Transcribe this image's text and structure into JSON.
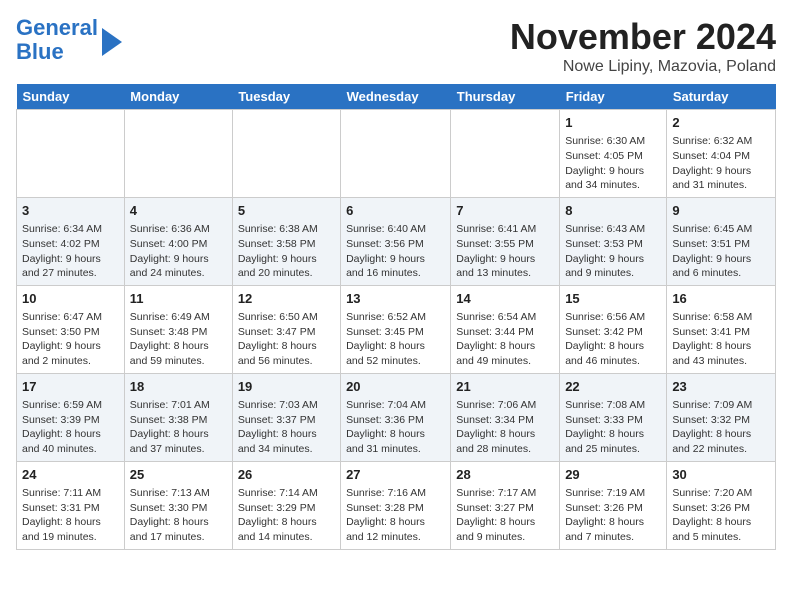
{
  "logo": {
    "line1": "General",
    "line2": "Blue"
  },
  "title": "November 2024",
  "location": "Nowe Lipiny, Mazovia, Poland",
  "weekdays": [
    "Sunday",
    "Monday",
    "Tuesday",
    "Wednesday",
    "Thursday",
    "Friday",
    "Saturday"
  ],
  "weeks": [
    [
      {
        "day": "",
        "info": ""
      },
      {
        "day": "",
        "info": ""
      },
      {
        "day": "",
        "info": ""
      },
      {
        "day": "",
        "info": ""
      },
      {
        "day": "",
        "info": ""
      },
      {
        "day": "1",
        "info": "Sunrise: 6:30 AM\nSunset: 4:05 PM\nDaylight: 9 hours\nand 34 minutes."
      },
      {
        "day": "2",
        "info": "Sunrise: 6:32 AM\nSunset: 4:04 PM\nDaylight: 9 hours\nand 31 minutes."
      }
    ],
    [
      {
        "day": "3",
        "info": "Sunrise: 6:34 AM\nSunset: 4:02 PM\nDaylight: 9 hours\nand 27 minutes."
      },
      {
        "day": "4",
        "info": "Sunrise: 6:36 AM\nSunset: 4:00 PM\nDaylight: 9 hours\nand 24 minutes."
      },
      {
        "day": "5",
        "info": "Sunrise: 6:38 AM\nSunset: 3:58 PM\nDaylight: 9 hours\nand 20 minutes."
      },
      {
        "day": "6",
        "info": "Sunrise: 6:40 AM\nSunset: 3:56 PM\nDaylight: 9 hours\nand 16 minutes."
      },
      {
        "day": "7",
        "info": "Sunrise: 6:41 AM\nSunset: 3:55 PM\nDaylight: 9 hours\nand 13 minutes."
      },
      {
        "day": "8",
        "info": "Sunrise: 6:43 AM\nSunset: 3:53 PM\nDaylight: 9 hours\nand 9 minutes."
      },
      {
        "day": "9",
        "info": "Sunrise: 6:45 AM\nSunset: 3:51 PM\nDaylight: 9 hours\nand 6 minutes."
      }
    ],
    [
      {
        "day": "10",
        "info": "Sunrise: 6:47 AM\nSunset: 3:50 PM\nDaylight: 9 hours\nand 2 minutes."
      },
      {
        "day": "11",
        "info": "Sunrise: 6:49 AM\nSunset: 3:48 PM\nDaylight: 8 hours\nand 59 minutes."
      },
      {
        "day": "12",
        "info": "Sunrise: 6:50 AM\nSunset: 3:47 PM\nDaylight: 8 hours\nand 56 minutes."
      },
      {
        "day": "13",
        "info": "Sunrise: 6:52 AM\nSunset: 3:45 PM\nDaylight: 8 hours\nand 52 minutes."
      },
      {
        "day": "14",
        "info": "Sunrise: 6:54 AM\nSunset: 3:44 PM\nDaylight: 8 hours\nand 49 minutes."
      },
      {
        "day": "15",
        "info": "Sunrise: 6:56 AM\nSunset: 3:42 PM\nDaylight: 8 hours\nand 46 minutes."
      },
      {
        "day": "16",
        "info": "Sunrise: 6:58 AM\nSunset: 3:41 PM\nDaylight: 8 hours\nand 43 minutes."
      }
    ],
    [
      {
        "day": "17",
        "info": "Sunrise: 6:59 AM\nSunset: 3:39 PM\nDaylight: 8 hours\nand 40 minutes."
      },
      {
        "day": "18",
        "info": "Sunrise: 7:01 AM\nSunset: 3:38 PM\nDaylight: 8 hours\nand 37 minutes."
      },
      {
        "day": "19",
        "info": "Sunrise: 7:03 AM\nSunset: 3:37 PM\nDaylight: 8 hours\nand 34 minutes."
      },
      {
        "day": "20",
        "info": "Sunrise: 7:04 AM\nSunset: 3:36 PM\nDaylight: 8 hours\nand 31 minutes."
      },
      {
        "day": "21",
        "info": "Sunrise: 7:06 AM\nSunset: 3:34 PM\nDaylight: 8 hours\nand 28 minutes."
      },
      {
        "day": "22",
        "info": "Sunrise: 7:08 AM\nSunset: 3:33 PM\nDaylight: 8 hours\nand 25 minutes."
      },
      {
        "day": "23",
        "info": "Sunrise: 7:09 AM\nSunset: 3:32 PM\nDaylight: 8 hours\nand 22 minutes."
      }
    ],
    [
      {
        "day": "24",
        "info": "Sunrise: 7:11 AM\nSunset: 3:31 PM\nDaylight: 8 hours\nand 19 minutes."
      },
      {
        "day": "25",
        "info": "Sunrise: 7:13 AM\nSunset: 3:30 PM\nDaylight: 8 hours\nand 17 minutes."
      },
      {
        "day": "26",
        "info": "Sunrise: 7:14 AM\nSunset: 3:29 PM\nDaylight: 8 hours\nand 14 minutes."
      },
      {
        "day": "27",
        "info": "Sunrise: 7:16 AM\nSunset: 3:28 PM\nDaylight: 8 hours\nand 12 minutes."
      },
      {
        "day": "28",
        "info": "Sunrise: 7:17 AM\nSunset: 3:27 PM\nDaylight: 8 hours\nand 9 minutes."
      },
      {
        "day": "29",
        "info": "Sunrise: 7:19 AM\nSunset: 3:26 PM\nDaylight: 8 hours\nand 7 minutes."
      },
      {
        "day": "30",
        "info": "Sunrise: 7:20 AM\nSunset: 3:26 PM\nDaylight: 8 hours\nand 5 minutes."
      }
    ]
  ]
}
